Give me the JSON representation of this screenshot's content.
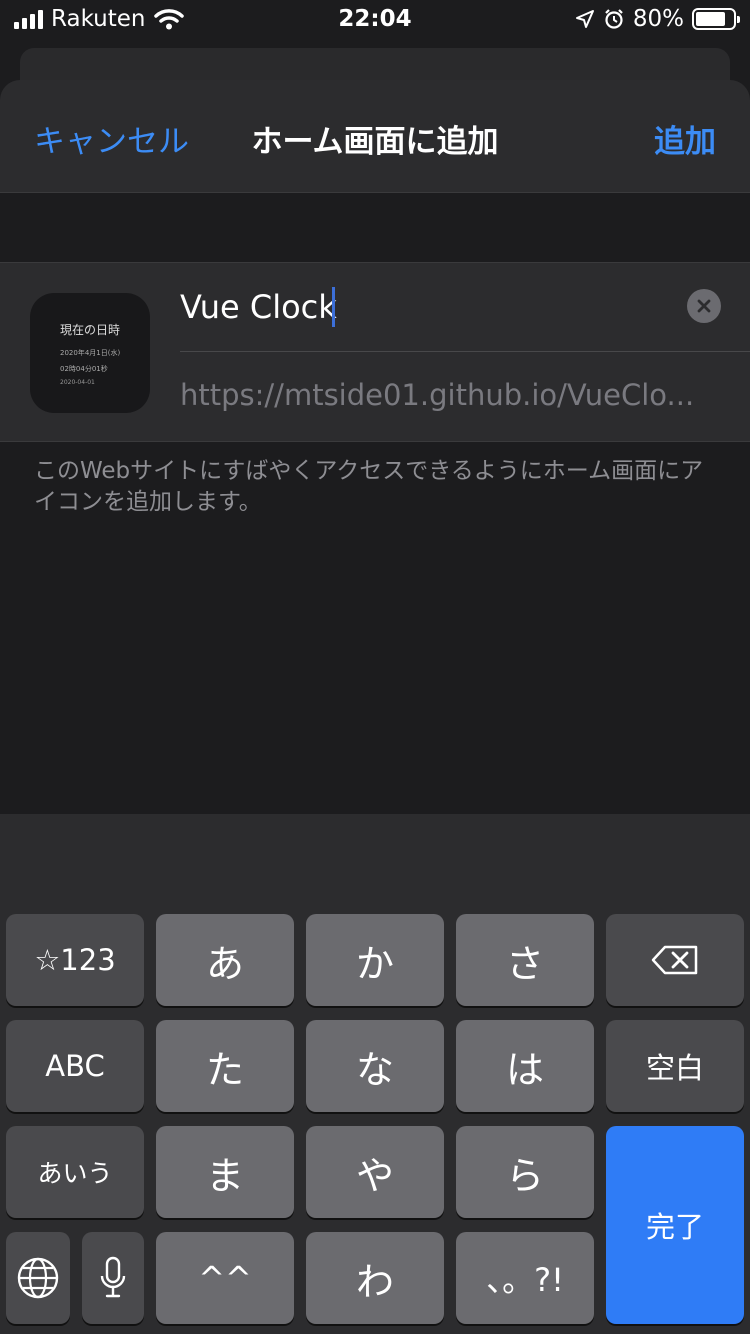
{
  "status_bar": {
    "carrier": "Rakuten",
    "time": "22:04",
    "battery_percent": "80%",
    "battery_level": 0.8,
    "icons": [
      "signal-icon",
      "wifi-icon",
      "location-icon",
      "alarm-icon",
      "battery-icon"
    ]
  },
  "sheet": {
    "cancel_label": "キャンセル",
    "title": "ホーム画面に追加",
    "add_label": "追加",
    "app_icon": {
      "line1": "現在の日時",
      "line2": "2020年4月1日(水)",
      "line3": "02時04分01秒",
      "line4": "2020-04-01"
    },
    "name_value": "Vue Clock",
    "url": "https://mtside01.github.io/VueClo...",
    "description": "このWebサイトにすばやくアクセスできるようにホーム画面にアイコンを追加します。"
  },
  "keyboard": {
    "row1": [
      "☆123",
      "あ",
      "か",
      "さ"
    ],
    "row2": [
      "ABC",
      "た",
      "な",
      "は",
      "空白"
    ],
    "row3": [
      "あいう",
      "ま",
      "や",
      "ら"
    ],
    "row4": [
      "^^",
      "わ",
      "、。?!"
    ],
    "done_label": "完了",
    "icons": [
      "backspace-icon",
      "globe-icon",
      "microphone-icon"
    ]
  },
  "colors": {
    "accent": "#3c8cf5",
    "done_key": "#2f7cf6",
    "background": "#1c1c1e"
  }
}
